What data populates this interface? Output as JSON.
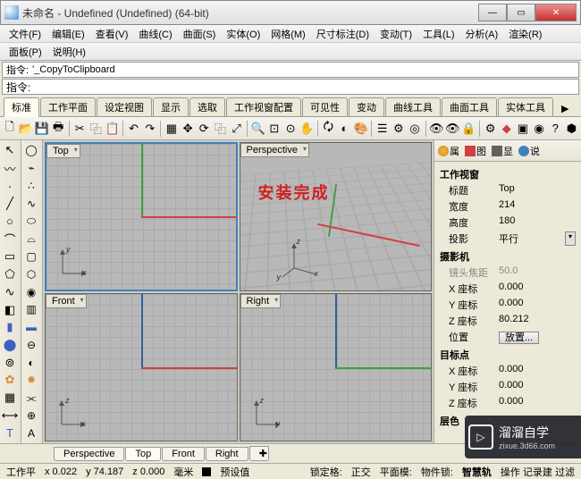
{
  "window": {
    "title": "未命名 - Undefined (Undefined) (64-bit)"
  },
  "menu": [
    "文件(F)",
    "编辑(E)",
    "查看(V)",
    "曲线(C)",
    "曲面(S)",
    "实体(O)",
    "网格(M)",
    "尺寸标注(D)",
    "变动(T)",
    "工具(L)",
    "分析(A)",
    "渲染(R)"
  ],
  "menu2": [
    "面板(P)",
    "说明(H)"
  ],
  "cmd1": {
    "label": "指令:",
    "value": "'_CopyToClipboard"
  },
  "cmd2": {
    "label": "指令:",
    "value": ""
  },
  "tabs": [
    "标准",
    "工作平面",
    "设定视图",
    "显示",
    "选取",
    "工作视窗配置",
    "可见性",
    "变动",
    "曲线工具",
    "曲面工具",
    "实体工具"
  ],
  "tabs_more": "▶",
  "viewports": {
    "top": "Top",
    "persp": "Perspective",
    "front": "Front",
    "right": "Right",
    "overlay": "安装完成"
  },
  "panel_tabs": {
    "t1": "属",
    "t2": "图",
    "t3": "显",
    "t4": "说"
  },
  "props": {
    "section_viewport": "工作视窗",
    "title_k": "标题",
    "title_v": "Top",
    "width_k": "宽度",
    "width_v": "214",
    "height_k": "高度",
    "height_v": "180",
    "proj_k": "投影",
    "proj_v": "平行",
    "section_camera": "摄影机",
    "focal_k": "镜头焦距",
    "focal_v": "50.0",
    "xloc_k": "X 座标",
    "xloc_v": "0.000",
    "yloc_k": "Y 座标",
    "yloc_v": "0.000",
    "zloc_k": "Z 座标",
    "zloc_v": "80.212",
    "pos_k": "位置",
    "pos_btn": "放置...",
    "section_target": "目标点",
    "tx_k": "X 座标",
    "tx_v": "0.000",
    "ty_k": "Y 座标",
    "ty_v": "0.000",
    "tz_k": "Z 座标",
    "tz_v": "0.000",
    "section_misc": "层色"
  },
  "bottom_tabs": [
    "Perspective",
    "Top",
    "Front",
    "Right"
  ],
  "status": {
    "cplane": "工作平",
    "x": "x 0.022",
    "y": "y 74.187",
    "z": "z 0.000",
    "unit": "毫米",
    "preset": "预设值",
    "snap": "锁定格:",
    "ortho": "正交",
    "planar": "平面模:",
    "osnap": "物件锁:",
    "smart": "智慧轨",
    "rest": "操作  记录建  过滤"
  },
  "watermark": {
    "title": "溜溜自学",
    "url": "zixue.3d66.com"
  }
}
